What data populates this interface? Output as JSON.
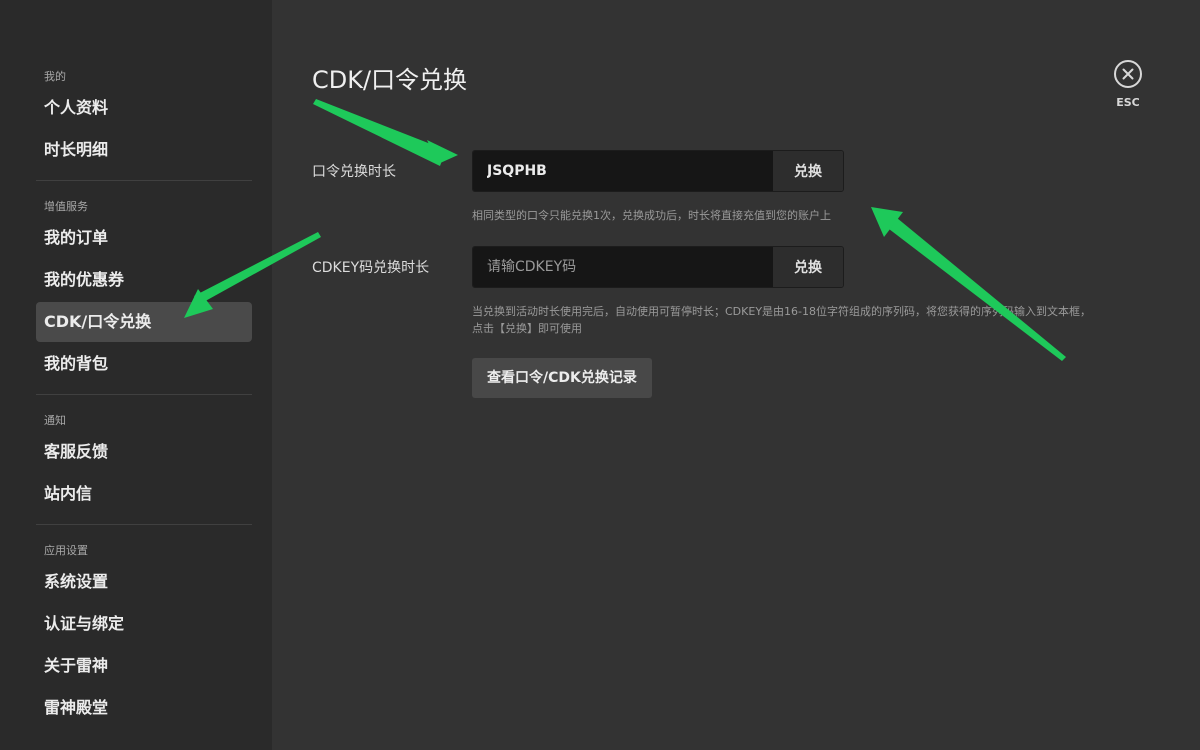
{
  "sidebar": {
    "groups": [
      {
        "title": "我的",
        "items": [
          "个人资料",
          "时长明细"
        ]
      },
      {
        "title": "增值服务",
        "items": [
          "我的订单",
          "我的优惠券",
          "CDK/口令兑换",
          "我的背包"
        ]
      },
      {
        "title": "通知",
        "items": [
          "客服反馈",
          "站内信"
        ]
      },
      {
        "title": "应用设置",
        "items": [
          "系统设置",
          "认证与绑定",
          "关于雷神",
          "雷神殿堂"
        ]
      }
    ]
  },
  "main": {
    "title": "CDK/口令兑换",
    "close": {
      "label": "ESC",
      "icon": "close-icon"
    },
    "code_redeem": {
      "label": "口令兑换时长",
      "value": "JSQPHB",
      "button": "兑换",
      "hint": "相同类型的口令只能兑换1次，兑换成功后，时长将直接充值到您的账户上"
    },
    "cdkey_redeem": {
      "label": "CDKEY码兑换时长",
      "placeholder": "请输CDKEY码",
      "button": "兑换",
      "hint": "当兑换到活动时长使用完后，自动使用可暂停时长；CDKEY是由16-18位字符组成的序列码，将您获得的序列码输入到文本框，点击【兑换】即可使用"
    },
    "history_button": "查看口令/CDK兑换记录"
  },
  "colors": {
    "arrow": "#1ec95a",
    "sidebar_bg": "#2a2a2a",
    "main_bg": "#333333",
    "active_item": "#4a4a4a"
  }
}
